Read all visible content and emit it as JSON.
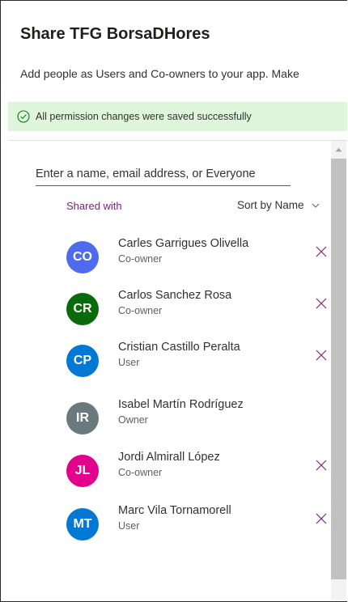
{
  "dialog": {
    "title": "Share TFG BorsaDHores",
    "description": "Add people as Users and Co-owners to your app. Make",
    "status_message": "All permission changes were saved successfully"
  },
  "search": {
    "placeholder": "Enter a name, email address, or Everyone"
  },
  "list": {
    "shared_with_label": "Shared with",
    "sort_label": "Sort by Name",
    "people": [
      {
        "initials": "CO",
        "name": "Carles Garrigues Olivella",
        "role": "Co-owner",
        "color": "#4f6bed",
        "removable": true
      },
      {
        "initials": "CR",
        "name": "Carlos Sanchez Rosa",
        "role": "Co-owner",
        "color": "#0b6a0b",
        "removable": true
      },
      {
        "initials": "CP",
        "name": "Cristian Castillo Peralta",
        "role": "User",
        "color": "#0078d4",
        "removable": true
      },
      {
        "initials": "IR",
        "name": "Isabel Martín Rodríguez",
        "role": "Owner",
        "color": "#69797e",
        "removable": false
      },
      {
        "initials": "JL",
        "name": "Jordi Almirall López",
        "role": "Co-owner",
        "color": "#e3008c",
        "removable": true
      },
      {
        "initials": "MT",
        "name": "Marc Vila Tornamorell",
        "role": "User",
        "color": "#0078d4",
        "removable": true
      }
    ]
  },
  "colors": {
    "accent": "#742774",
    "success_bg": "#dff6dd",
    "success_icon": "#107c10"
  }
}
